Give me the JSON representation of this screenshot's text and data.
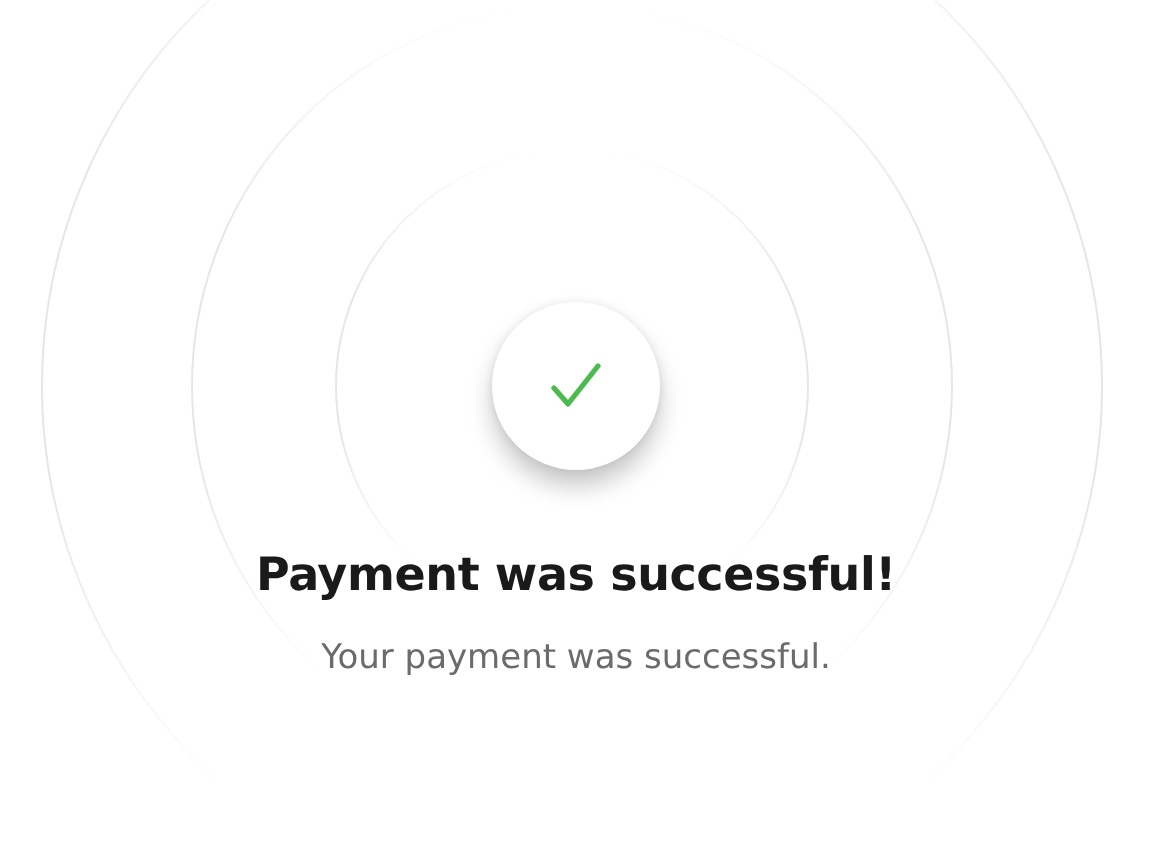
{
  "kind": "success",
  "title": "Payment was successful!",
  "message": "Your payment was successful."
}
